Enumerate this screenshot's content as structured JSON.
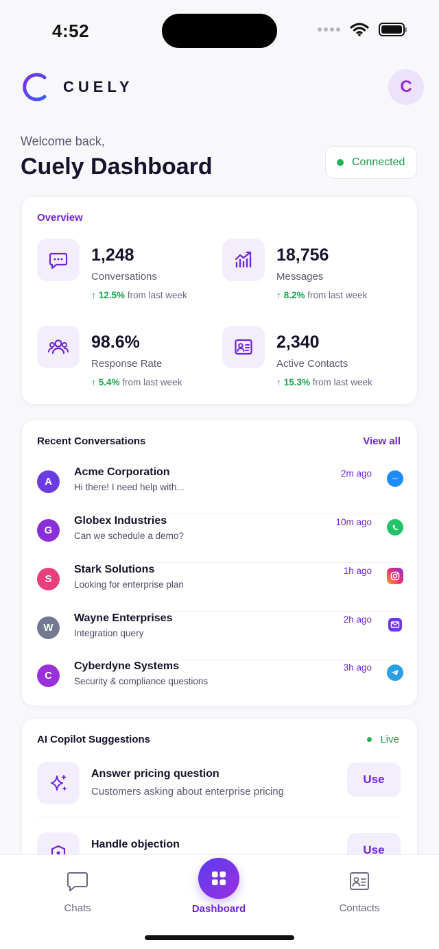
{
  "status_bar": {
    "time": "4:52"
  },
  "brand": {
    "name": "CUELY"
  },
  "user": {
    "initial": "C"
  },
  "header": {
    "welcome": "Welcome back,",
    "title": "Cuely Dashboard",
    "connection_status": "Connected"
  },
  "overview": {
    "title": "Overview",
    "stats": [
      {
        "value": "1,248",
        "label": "Conversations",
        "delta": "12.5%",
        "delta_suffix": "from last week",
        "icon": "chat-bubble-icon"
      },
      {
        "value": "18,756",
        "label": "Messages",
        "delta": "8.2%",
        "delta_suffix": "from last week",
        "icon": "bar-chart-trend-icon"
      },
      {
        "value": "98.6%",
        "label": "Response Rate",
        "delta": "5.4%",
        "delta_suffix": "from last week",
        "icon": "users-icon"
      },
      {
        "value": "2,340",
        "label": "Active Contacts",
        "delta": "15.3%",
        "delta_suffix": "from last week",
        "icon": "contact-card-icon"
      }
    ]
  },
  "recent": {
    "title": "Recent Conversations",
    "view_all": "View all",
    "items": [
      {
        "initial": "A",
        "name": "Acme Corporation",
        "message": "Hi there! I need help with...",
        "time": "2m ago",
        "channel": "messenger-icon",
        "color": "#6a3be0"
      },
      {
        "initial": "G",
        "name": "Globex Industries",
        "message": "Can we schedule a demo?",
        "time": "10m ago",
        "channel": "whatsapp-icon",
        "color": "#8a2fd8"
      },
      {
        "initial": "S",
        "name": "Stark Solutions",
        "message": "Looking for enterprise plan",
        "time": "1h ago",
        "channel": "instagram-icon",
        "color": "#e83f7c"
      },
      {
        "initial": "W",
        "name": "Wayne Enterprises",
        "message": "Integration query",
        "time": "2h ago",
        "channel": "email-icon",
        "color": "#747890"
      },
      {
        "initial": "C",
        "name": "Cyberdyne Systems",
        "message": "Security & compliance questions",
        "time": "3h ago",
        "channel": "telegram-icon",
        "color": "#9a30d8"
      }
    ]
  },
  "copilot": {
    "title": "AI Copilot Suggestions",
    "live": "Live",
    "suggestions": [
      {
        "title": "Answer pricing question",
        "desc": "Customers asking about enterprise pricing",
        "action": "Use",
        "icon": "sparkles-icon"
      },
      {
        "title": "Handle objection",
        "desc": "",
        "action": "Use",
        "icon": "shield-icon"
      }
    ]
  },
  "tabbar": {
    "chats": "Chats",
    "dashboard": "Dashboard",
    "contacts": "Contacts"
  },
  "colors": {
    "accent": "#6d25d6",
    "positive": "#1aa34f",
    "background": "#f8f8fb"
  }
}
